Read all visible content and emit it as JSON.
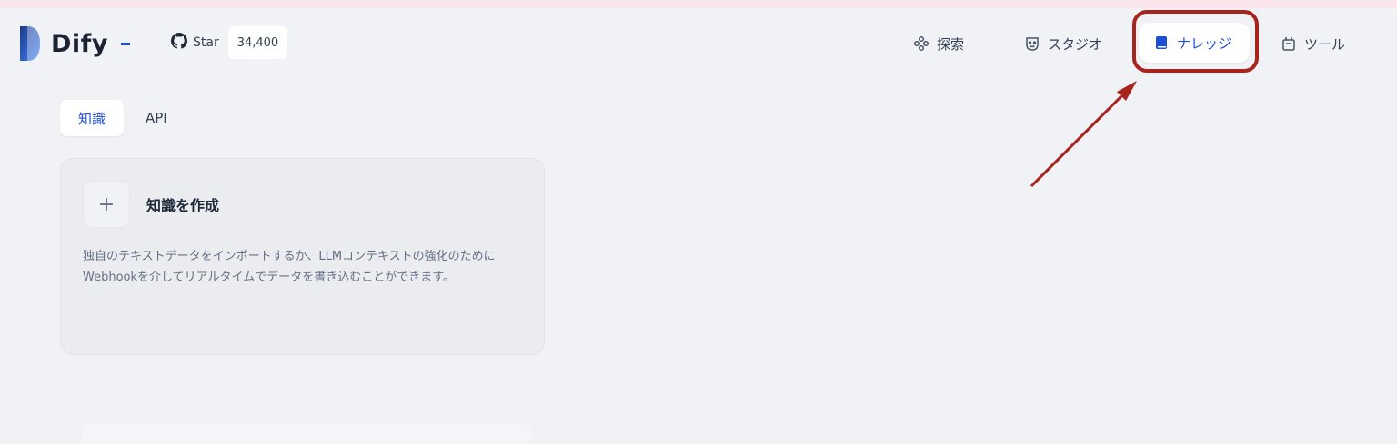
{
  "header": {
    "brand": "Dify",
    "github_star_label": "Star",
    "github_star_count": "34,400",
    "nav": [
      {
        "label": "探索",
        "icon": "explore-icon"
      },
      {
        "label": "スタジオ",
        "icon": "studio-icon"
      },
      {
        "label": "ナレッジ",
        "icon": "knowledge-icon",
        "active": true
      },
      {
        "label": "ツール",
        "icon": "tools-icon"
      }
    ]
  },
  "tabs": [
    {
      "label": "知識",
      "active": true
    },
    {
      "label": "API",
      "active": false
    }
  ],
  "create_card": {
    "plus": "+",
    "title": "知識を作成",
    "description": "独自のテキストデータをインポートするか、LLMコンテキストの強化のためにWebhookを介してリアルタイムでデータを書き込むことができます。"
  },
  "colors": {
    "accent": "#1d4ed8",
    "annotation": "#a8231c",
    "background": "#f1f2f6"
  }
}
